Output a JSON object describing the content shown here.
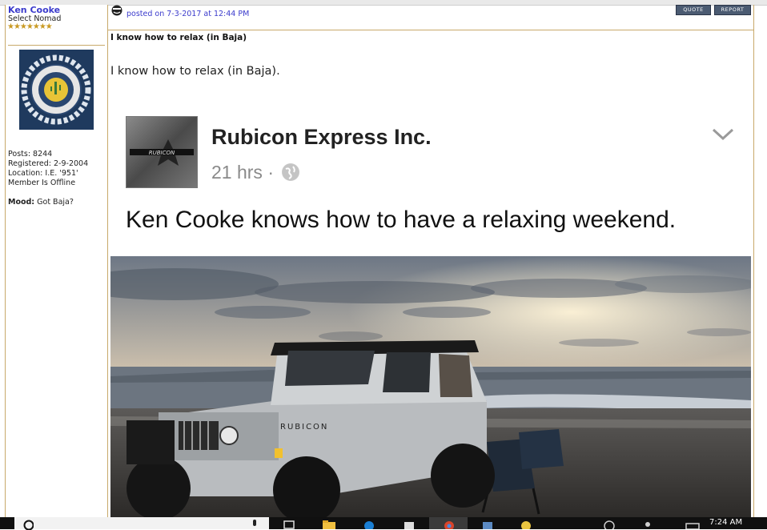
{
  "user": {
    "name": "Ken Cooke",
    "rank": "Select Nomad",
    "stars": "★★★★★★★",
    "stats": [
      "Posts: 8244",
      "Registered: 2-9-2004",
      "Location: I.E. '951'",
      "Member Is Offline"
    ],
    "mood_label": "Mood:",
    "mood_value": "Got Baja?"
  },
  "post": {
    "posted": "posted on 7-3-2017 at 12:44 PM",
    "quote_label": "QUOTE",
    "report_label": "REPORT",
    "title": "I know how to relax (in Baja)",
    "body": "I know how to relax (in Baja)."
  },
  "embed": {
    "page_name": "Rubicon Express Inc.",
    "time": "21 hrs · ",
    "text": "Ken Cooke knows how to have a relaxing weekend.",
    "photo_badge": "RUBICON"
  },
  "taskbar": {
    "clock": "7:24 AM"
  },
  "colors": {
    "link": "#3b3bcc",
    "border": "#c8a96a",
    "button": "#4b5b72"
  }
}
